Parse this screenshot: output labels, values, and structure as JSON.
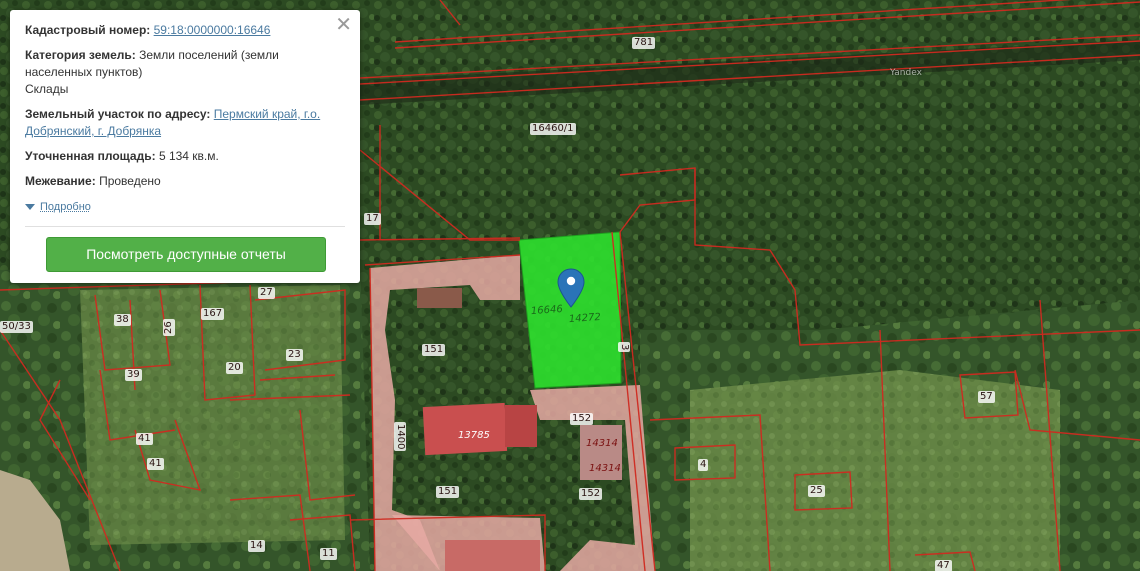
{
  "popup": {
    "cadastral_label": "Кадастровый номер:",
    "cadastral_value": "59:18:0000000:16646",
    "category_label": "Категория земель:",
    "category_value": "Земли поселений (земли населенных пунктов)",
    "use_value": "Склады",
    "address_label": "Земельный участок по адресу:",
    "address_value": "Пермский край, г.о. Добрянский, г. Добрянка",
    "area_label": "Уточненная площадь:",
    "area_value": "5 134 кв.м.",
    "survey_label": "Межевание:",
    "survey_value": "Проведено",
    "more_link": "Подробно",
    "reports_button": "Посмотреть доступные отчеты",
    "close_icon": "close-icon"
  },
  "map": {
    "highlight_color": "#2ee02e",
    "boundary_color": "#d02a20",
    "parcel_labels": [
      {
        "text": "781"
      },
      {
        "text": "16460/1"
      },
      {
        "text": "17"
      },
      {
        "text": "27"
      },
      {
        "text": "167"
      },
      {
        "text": "38"
      },
      {
        "text": "26"
      },
      {
        "text": "23"
      },
      {
        "text": "20"
      },
      {
        "text": "39"
      },
      {
        "text": "41"
      },
      {
        "text": "41"
      },
      {
        "text": "50/33"
      },
      {
        "text": "151"
      },
      {
        "text": "151"
      },
      {
        "text": "1400"
      },
      {
        "text": "13785"
      },
      {
        "text": "152"
      },
      {
        "text": "152"
      },
      {
        "text": "14314"
      },
      {
        "text": "14314"
      },
      {
        "text": "16646"
      },
      {
        "text": "14272"
      },
      {
        "text": "3"
      },
      {
        "text": "57"
      },
      {
        "text": "4"
      },
      {
        "text": "25"
      },
      {
        "text": "14"
      },
      {
        "text": "11"
      },
      {
        "text": "47"
      }
    ],
    "watermark": "Yandex",
    "marker_icon": "map-pin-icon"
  }
}
